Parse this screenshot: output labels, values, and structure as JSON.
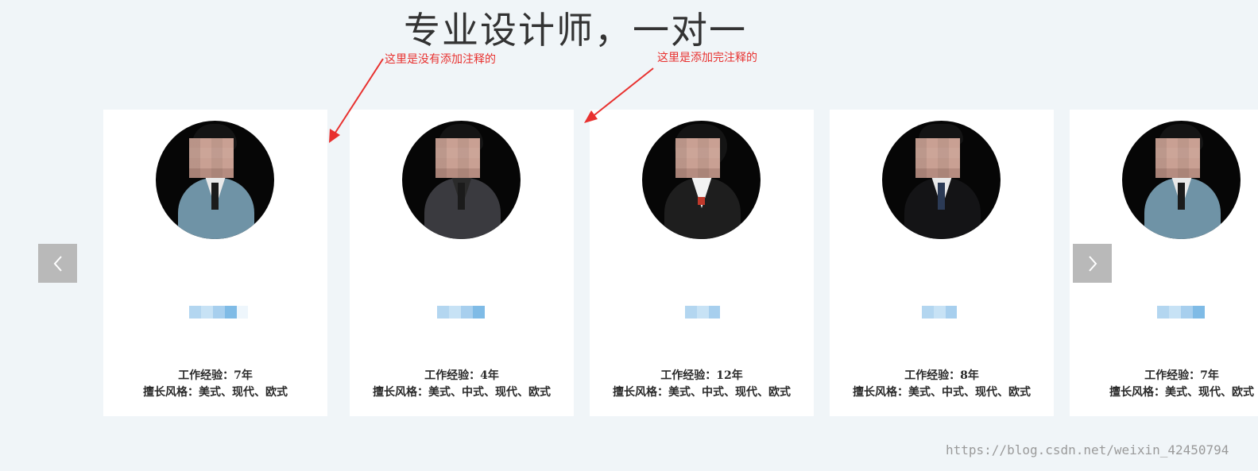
{
  "page": {
    "title": "专业设计师，一对一"
  },
  "annotations": [
    {
      "text": "这里是没有添加注释的"
    },
    {
      "text": "这里是添加完注释的"
    }
  ],
  "colors": {
    "annotation": "#e8312f",
    "background": "#f0f5f8",
    "card": "#ffffff",
    "nav_button": "#b9b9b9"
  },
  "carousel": {
    "prev_icon": "chevron-left-icon",
    "next_icon": "chevron-right-icon",
    "cards": [
      {
        "experience": "工作经验：7年",
        "styles": "擅长风格：美式、现代、欧式",
        "suit_color": "#6f93a6"
      },
      {
        "experience": "工作经验：4年",
        "styles": "擅长风格：美式、中式、现代、欧式",
        "suit_color": "#3a3a3f"
      },
      {
        "experience": "工作经验：12年",
        "styles": "擅长风格：美式、中式、现代、欧式",
        "suit_color": "#1e1e1e"
      },
      {
        "experience": "工作经验：8年",
        "styles": "擅长风格：美式、中式、现代、欧式",
        "suit_color": "#141416"
      },
      {
        "experience": "工作经验：7年",
        "styles": "擅长风格：美式、现代、欧式",
        "suit_color": "#6f93a6"
      }
    ]
  },
  "watermark": "https://blog.csdn.net/weixin_42450794"
}
